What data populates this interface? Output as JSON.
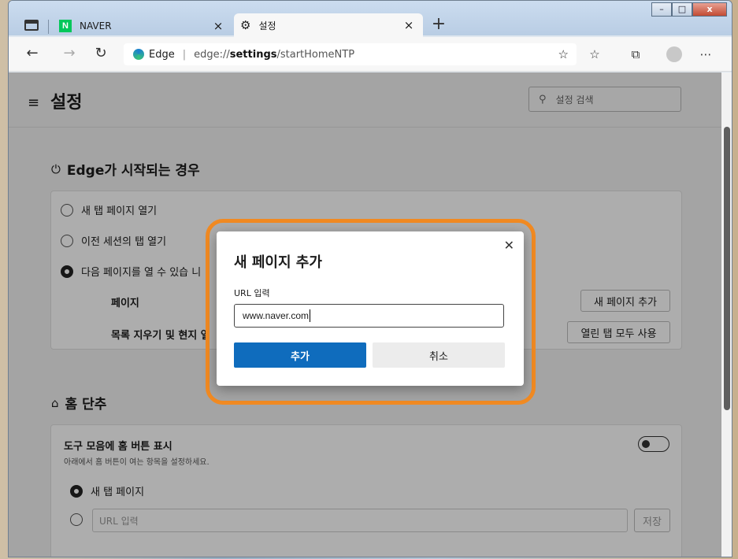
{
  "tabs": [
    {
      "title": "NAVER",
      "favicon": "N",
      "close": "×"
    },
    {
      "title": "설정",
      "close": "×"
    }
  ],
  "newtab": "+",
  "window_controls": {
    "minimize": "–",
    "maximize": "□",
    "close": "x"
  },
  "address": {
    "brand": "Edge",
    "separator": "|",
    "scheme": "edge://",
    "host": "settings",
    "path": "/startHomeNTP"
  },
  "settings": {
    "title": "설정",
    "search_placeholder": "설정 검색",
    "startup": {
      "title": "Edge가 시작되는 경우",
      "options": [
        "새 탭 페이지 열기",
        "이전 세션의 탭 열기",
        "다음 페이지를 열 수 있습 니"
      ],
      "selected_index": 2,
      "pages_label": "페이지",
      "clear_label": "목록 지우기 및 현지 열",
      "add_page_button": "새 페이지 추가",
      "use_open_tabs_button": "열린 탭 모두 사용"
    },
    "home": {
      "title": "홈 단추",
      "toolbar_label": "도구 모음에 홈 버튼 표시",
      "toolbar_desc": "아래에서 홈 버튼이 여는 항목을 설정하세요.",
      "toggle_on": false,
      "option_newtab": "새 탭 페이지",
      "url_placeholder": "URL 입력",
      "save_button": "저장"
    }
  },
  "dialog": {
    "title": "새 페이지 추가",
    "url_label": "URL 입력",
    "url_value": "www.naver.com",
    "add_button": "추가",
    "cancel_button": "취소",
    "close": "✕"
  },
  "colors": {
    "highlight_ring": "#f18a22",
    "primary_button": "#0f6cbd",
    "naver_green": "#03c75a"
  }
}
